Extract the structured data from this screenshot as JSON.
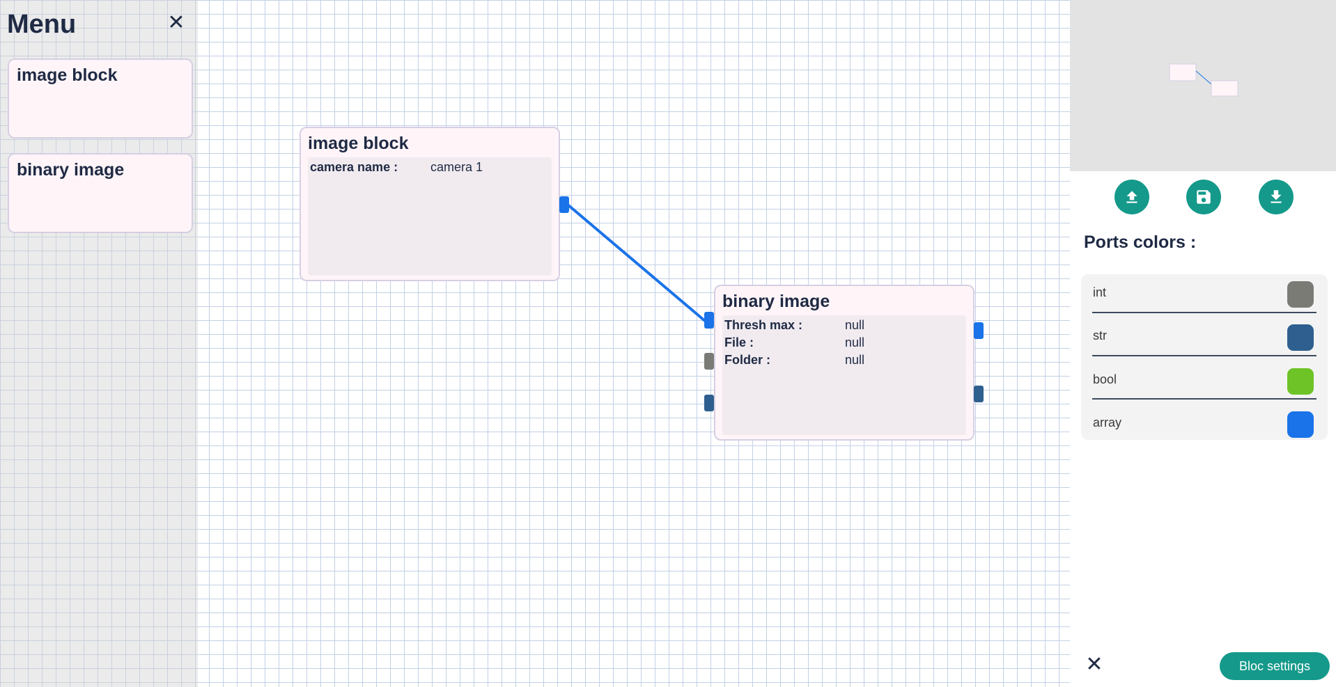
{
  "menu": {
    "title": "Menu",
    "close_icon": "close-icon",
    "items": [
      {
        "label": "image block"
      },
      {
        "label": "binary image"
      }
    ]
  },
  "canvas": {
    "nodes": [
      {
        "title": "image block",
        "properties": [
          {
            "label": "camera name :",
            "value": "camera 1"
          }
        ]
      },
      {
        "title": "binary image",
        "properties": [
          {
            "label": "Thresh max :",
            "value": "null"
          },
          {
            "label": "File :",
            "value": "null"
          },
          {
            "label": "Folder :",
            "value": "null"
          }
        ]
      }
    ],
    "connection_color": "#1a73e8"
  },
  "toolbar": {
    "upload_icon": "upload-icon",
    "save_icon": "save-icon",
    "download_icon": "download-icon"
  },
  "ports_panel": {
    "title": "Ports colors :",
    "types": [
      {
        "name": "int",
        "color": "#7b7b76"
      },
      {
        "name": "str",
        "color": "#2e5f8e"
      },
      {
        "name": "bool",
        "color": "#6ec427"
      },
      {
        "name": "array",
        "color": "#1a73e8"
      }
    ]
  },
  "footer": {
    "close_icon": "close-icon",
    "bloc_settings_label": "Bloc settings"
  },
  "colors": {
    "accent": "#14998a",
    "node_background": "#fff5f8",
    "grid_line": "#c3d0e6"
  }
}
